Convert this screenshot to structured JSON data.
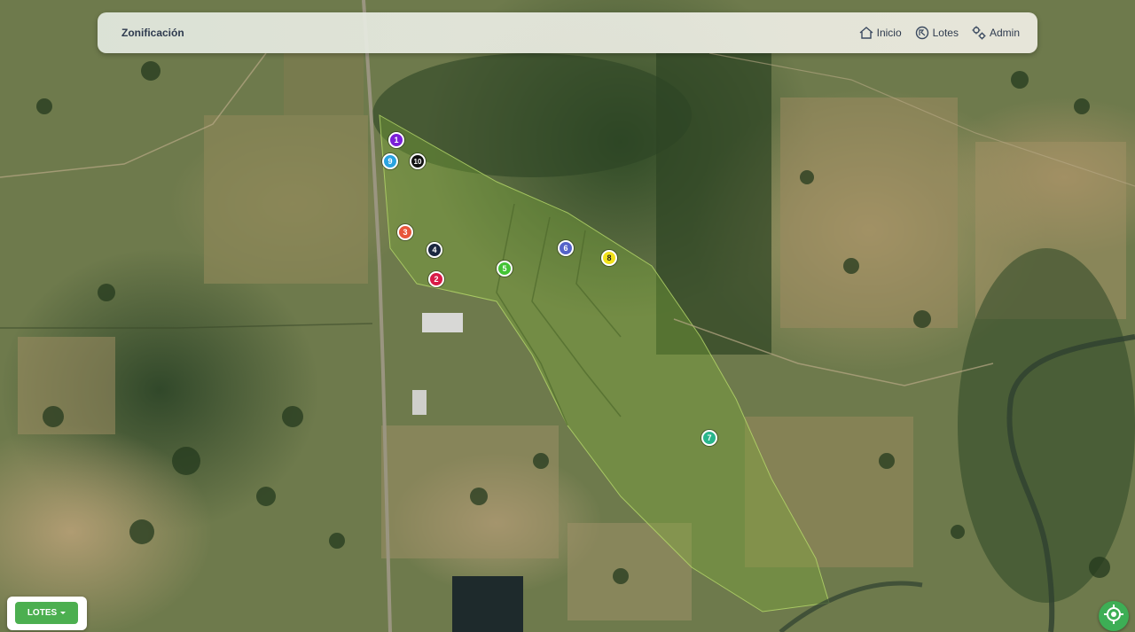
{
  "header": {
    "brand": "Zonificación",
    "nav": [
      {
        "label": "Inicio",
        "icon": "home-icon"
      },
      {
        "label": "Lotes",
        "icon": "lotes-icon"
      },
      {
        "label": "Admin",
        "icon": "gears-icon"
      }
    ]
  },
  "markers": [
    {
      "label": "1",
      "color": "#7b1fd8"
    },
    {
      "label": "2",
      "color": "#d81b48"
    },
    {
      "label": "3",
      "color": "#e8553a"
    },
    {
      "label": "4",
      "color": "#1b2740"
    },
    {
      "label": "5",
      "color": "#43c334"
    },
    {
      "label": "6",
      "color": "#5563c9"
    },
    {
      "label": "7",
      "color": "#2ab58c"
    },
    {
      "label": "8",
      "color": "#f2e21a"
    },
    {
      "label": "9",
      "color": "#2aa3e0"
    },
    {
      "label": "10",
      "color": "#111111"
    }
  ],
  "controls": {
    "lotes_button": "LOTES",
    "locate_icon": "locate-icon"
  }
}
